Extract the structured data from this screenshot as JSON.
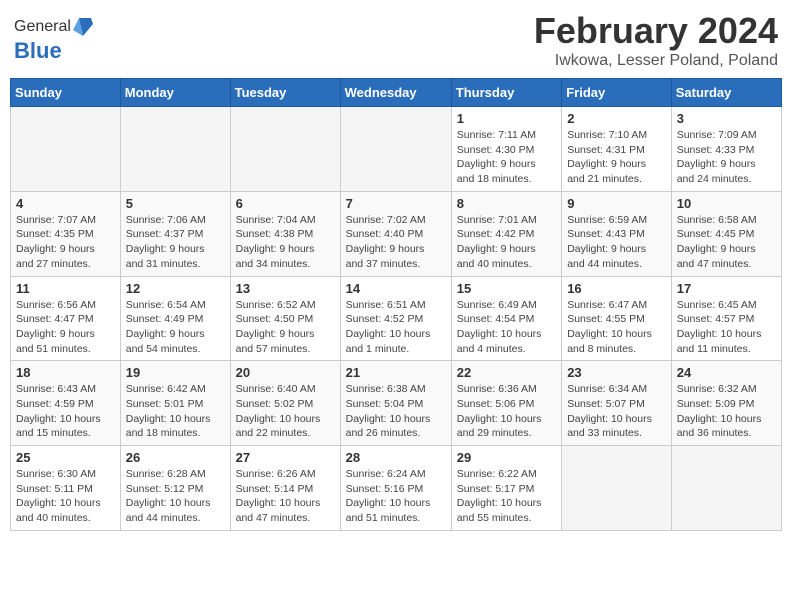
{
  "header": {
    "logo_general": "General",
    "logo_blue": "Blue",
    "title": "February 2024",
    "subtitle": "Iwkowa, Lesser Poland, Poland"
  },
  "weekdays": [
    "Sunday",
    "Monday",
    "Tuesday",
    "Wednesday",
    "Thursday",
    "Friday",
    "Saturday"
  ],
  "weeks": [
    [
      {
        "day": "",
        "info": ""
      },
      {
        "day": "",
        "info": ""
      },
      {
        "day": "",
        "info": ""
      },
      {
        "day": "",
        "info": ""
      },
      {
        "day": "1",
        "info": "Sunrise: 7:11 AM\nSunset: 4:30 PM\nDaylight: 9 hours\nand 18 minutes."
      },
      {
        "day": "2",
        "info": "Sunrise: 7:10 AM\nSunset: 4:31 PM\nDaylight: 9 hours\nand 21 minutes."
      },
      {
        "day": "3",
        "info": "Sunrise: 7:09 AM\nSunset: 4:33 PM\nDaylight: 9 hours\nand 24 minutes."
      }
    ],
    [
      {
        "day": "4",
        "info": "Sunrise: 7:07 AM\nSunset: 4:35 PM\nDaylight: 9 hours\nand 27 minutes."
      },
      {
        "day": "5",
        "info": "Sunrise: 7:06 AM\nSunset: 4:37 PM\nDaylight: 9 hours\nand 31 minutes."
      },
      {
        "day": "6",
        "info": "Sunrise: 7:04 AM\nSunset: 4:38 PM\nDaylight: 9 hours\nand 34 minutes."
      },
      {
        "day": "7",
        "info": "Sunrise: 7:02 AM\nSunset: 4:40 PM\nDaylight: 9 hours\nand 37 minutes."
      },
      {
        "day": "8",
        "info": "Sunrise: 7:01 AM\nSunset: 4:42 PM\nDaylight: 9 hours\nand 40 minutes."
      },
      {
        "day": "9",
        "info": "Sunrise: 6:59 AM\nSunset: 4:43 PM\nDaylight: 9 hours\nand 44 minutes."
      },
      {
        "day": "10",
        "info": "Sunrise: 6:58 AM\nSunset: 4:45 PM\nDaylight: 9 hours\nand 47 minutes."
      }
    ],
    [
      {
        "day": "11",
        "info": "Sunrise: 6:56 AM\nSunset: 4:47 PM\nDaylight: 9 hours\nand 51 minutes."
      },
      {
        "day": "12",
        "info": "Sunrise: 6:54 AM\nSunset: 4:49 PM\nDaylight: 9 hours\nand 54 minutes."
      },
      {
        "day": "13",
        "info": "Sunrise: 6:52 AM\nSunset: 4:50 PM\nDaylight: 9 hours\nand 57 minutes."
      },
      {
        "day": "14",
        "info": "Sunrise: 6:51 AM\nSunset: 4:52 PM\nDaylight: 10 hours\nand 1 minute."
      },
      {
        "day": "15",
        "info": "Sunrise: 6:49 AM\nSunset: 4:54 PM\nDaylight: 10 hours\nand 4 minutes."
      },
      {
        "day": "16",
        "info": "Sunrise: 6:47 AM\nSunset: 4:55 PM\nDaylight: 10 hours\nand 8 minutes."
      },
      {
        "day": "17",
        "info": "Sunrise: 6:45 AM\nSunset: 4:57 PM\nDaylight: 10 hours\nand 11 minutes."
      }
    ],
    [
      {
        "day": "18",
        "info": "Sunrise: 6:43 AM\nSunset: 4:59 PM\nDaylight: 10 hours\nand 15 minutes."
      },
      {
        "day": "19",
        "info": "Sunrise: 6:42 AM\nSunset: 5:01 PM\nDaylight: 10 hours\nand 18 minutes."
      },
      {
        "day": "20",
        "info": "Sunrise: 6:40 AM\nSunset: 5:02 PM\nDaylight: 10 hours\nand 22 minutes."
      },
      {
        "day": "21",
        "info": "Sunrise: 6:38 AM\nSunset: 5:04 PM\nDaylight: 10 hours\nand 26 minutes."
      },
      {
        "day": "22",
        "info": "Sunrise: 6:36 AM\nSunset: 5:06 PM\nDaylight: 10 hours\nand 29 minutes."
      },
      {
        "day": "23",
        "info": "Sunrise: 6:34 AM\nSunset: 5:07 PM\nDaylight: 10 hours\nand 33 minutes."
      },
      {
        "day": "24",
        "info": "Sunrise: 6:32 AM\nSunset: 5:09 PM\nDaylight: 10 hours\nand 36 minutes."
      }
    ],
    [
      {
        "day": "25",
        "info": "Sunrise: 6:30 AM\nSunset: 5:11 PM\nDaylight: 10 hours\nand 40 minutes."
      },
      {
        "day": "26",
        "info": "Sunrise: 6:28 AM\nSunset: 5:12 PM\nDaylight: 10 hours\nand 44 minutes."
      },
      {
        "day": "27",
        "info": "Sunrise: 6:26 AM\nSunset: 5:14 PM\nDaylight: 10 hours\nand 47 minutes."
      },
      {
        "day": "28",
        "info": "Sunrise: 6:24 AM\nSunset: 5:16 PM\nDaylight: 10 hours\nand 51 minutes."
      },
      {
        "day": "29",
        "info": "Sunrise: 6:22 AM\nSunset: 5:17 PM\nDaylight: 10 hours\nand 55 minutes."
      },
      {
        "day": "",
        "info": ""
      },
      {
        "day": "",
        "info": ""
      }
    ]
  ]
}
